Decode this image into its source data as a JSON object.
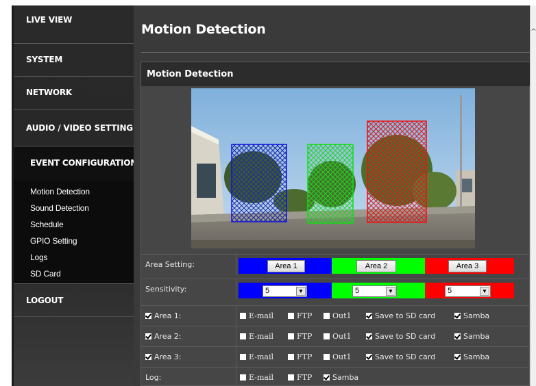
{
  "sidebar": {
    "live_view": "LIVE VIEW",
    "system": "SYSTEM",
    "network": "NETWORK",
    "audio_video": "AUDIO / VIDEO SETTING",
    "event_configuration": "EVENT CONFIGURATION",
    "sub_items": [
      "Motion Detection",
      "Sound Detection",
      "Schedule",
      "GPIO Setting",
      "Logs",
      "SD Card"
    ],
    "logout": "LOGOUT"
  },
  "main": {
    "title": "Motion Detection",
    "panel_title": "Motion Detection",
    "area_setting": {
      "label": "Area Setting:",
      "areas": [
        {
          "button": "Area 1",
          "color": "#0000ff"
        },
        {
          "button": "Area 2",
          "color": "#00ff00"
        },
        {
          "button": "Area 3",
          "color": "#ff0000"
        }
      ]
    },
    "sensitivity": {
      "label": "Sensitivity:",
      "values": [
        "5",
        "5",
        "5"
      ]
    },
    "area_rows": [
      {
        "label": "Area 1:",
        "checked": true,
        "email": "E-mail",
        "ftp": "FTP",
        "out": "Out1",
        "sd": "Save to SD card",
        "samba": "Samba"
      },
      {
        "label": "Area 2:",
        "checked": true,
        "email": "E-mail",
        "ftp": "FTP",
        "out": "Out1",
        "sd": "Save to SD card",
        "samba": "Samba"
      },
      {
        "label": "Area 3:",
        "checked": true,
        "email": "E-mail",
        "ftp": "FTP",
        "out": "Out1",
        "sd": "Save to SD card",
        "samba": "Samba"
      }
    ],
    "log_row": {
      "label": "Log:",
      "email": "E-mail",
      "ftp": "FTP",
      "samba": "Samba"
    }
  }
}
